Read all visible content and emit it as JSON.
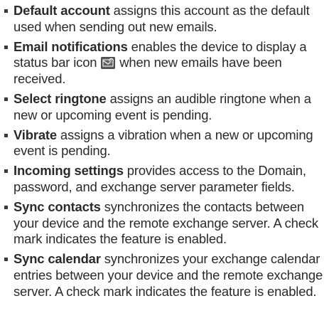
{
  "items": [
    {
      "term": "Default account",
      "description": " assigns this account as the default used when sending out new emails."
    },
    {
      "term": "Email notifications",
      "description_before_icon": " enables the device to display a status bar icon ",
      "icon": "new-email-notification-icon",
      "description_after_icon": " when new emails have been received."
    },
    {
      "term": "Select ringtone",
      "description": " assigns an audible ringtone when a new or upcoming event is pending."
    },
    {
      "term": "Vibrate",
      "description": " assigns a vibration when a new or upcoming event is pending."
    },
    {
      "term": "Incoming settings",
      "description": " provides access to the Domain, password, and exchange server parameter fields."
    },
    {
      "term": "Sync contacts",
      "description": " synchronizes the contacts between your device and the remote exchange server. A check mark indicates the feature is enabled."
    },
    {
      "term": "Sync calendar",
      "description": " synchronizes your exchange calendar entries between your device and the remote exchange server. A check mark indicates the feature is enabled."
    }
  ]
}
